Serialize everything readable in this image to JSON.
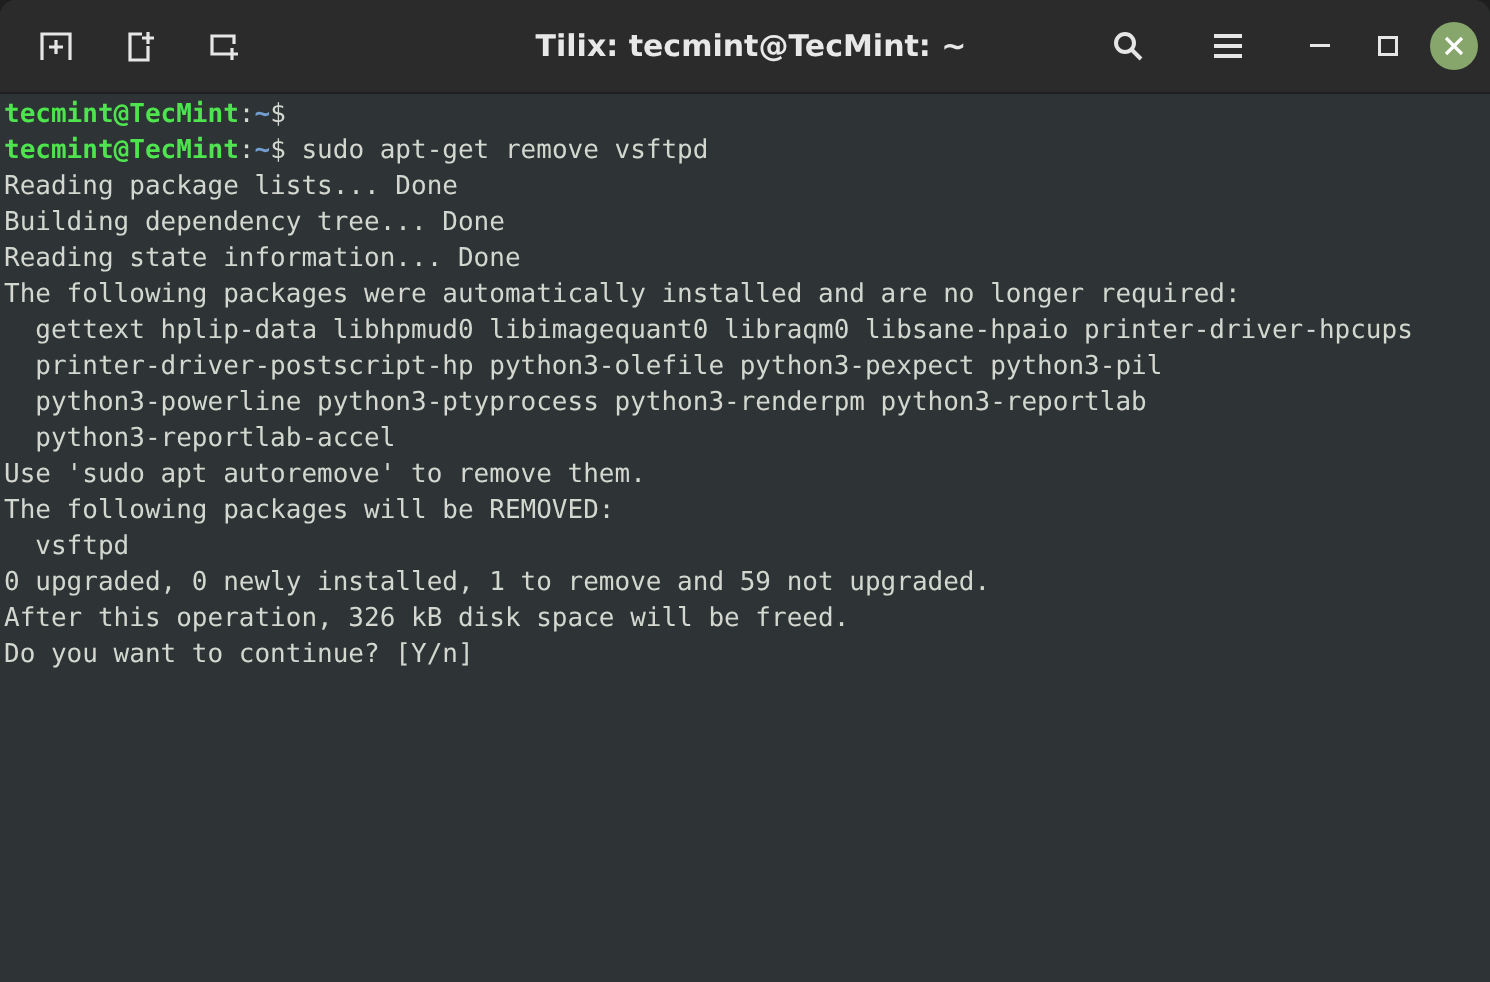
{
  "window": {
    "title": "Tilix: tecmint@TecMint: ~"
  },
  "terminal": {
    "lines": [
      {
        "kind": "prompt",
        "user": "tecmint@TecMint",
        "separator": ":",
        "path": "~",
        "symbol": "$"
      },
      {
        "kind": "prompt",
        "user": "tecmint@TecMint",
        "separator": ":",
        "path": "~",
        "symbol": "$",
        "command": " sudo apt-get remove vsftpd"
      },
      {
        "kind": "output",
        "text": "Reading package lists... Done"
      },
      {
        "kind": "output",
        "text": "Building dependency tree... Done"
      },
      {
        "kind": "output",
        "text": "Reading state information... Done"
      },
      {
        "kind": "output",
        "text": "The following packages were automatically installed and are no longer required:"
      },
      {
        "kind": "output",
        "text": "  gettext hplip-data libhpmud0 libimagequant0 libraqm0 libsane-hpaio printer-driver-hpcups"
      },
      {
        "kind": "output",
        "text": "  printer-driver-postscript-hp python3-olefile python3-pexpect python3-pil"
      },
      {
        "kind": "output",
        "text": "  python3-powerline python3-ptyprocess python3-renderpm python3-reportlab"
      },
      {
        "kind": "output",
        "text": "  python3-reportlab-accel"
      },
      {
        "kind": "output",
        "text": "Use 'sudo apt autoremove' to remove them."
      },
      {
        "kind": "output",
        "text": "The following packages will be REMOVED:"
      },
      {
        "kind": "output",
        "text": "  vsftpd"
      },
      {
        "kind": "output",
        "text": "0 upgraded, 0 newly installed, 1 to remove and 59 not upgraded."
      },
      {
        "kind": "output",
        "text": "After this operation, 326 kB disk space will be freed."
      },
      {
        "kind": "output",
        "text": "Do you want to continue? [Y/n]"
      }
    ]
  }
}
